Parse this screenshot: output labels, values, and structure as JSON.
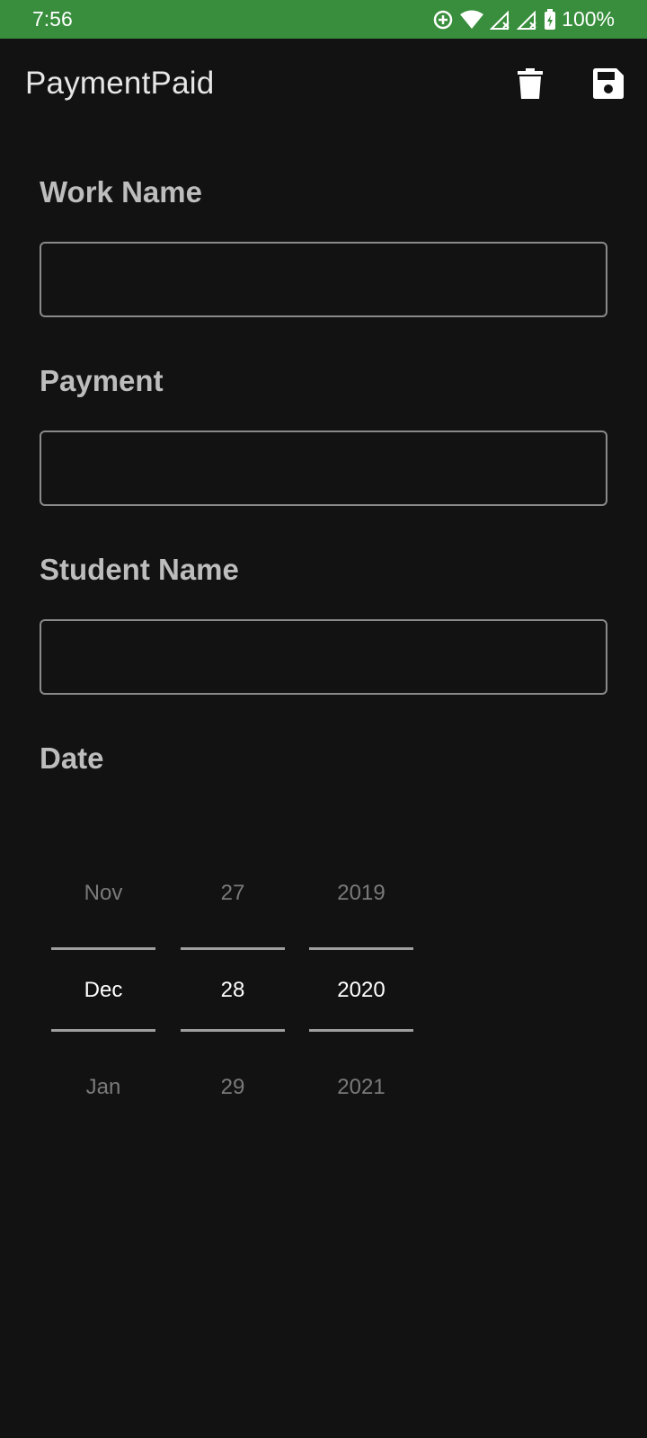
{
  "status_bar": {
    "time": "7:56",
    "battery": "100%",
    "icons": [
      "data-saver-icon",
      "wifi-icon",
      "signal-icon",
      "signal-icon",
      "battery-charging-icon"
    ],
    "background_color": "#388e3c"
  },
  "app_bar": {
    "title": "PaymentPaid",
    "actions": [
      {
        "name": "delete",
        "icon": "trash-icon"
      },
      {
        "name": "save",
        "icon": "save-icon"
      }
    ]
  },
  "form": {
    "work_name": {
      "label": "Work Name",
      "value": "",
      "placeholder": ""
    },
    "payment": {
      "label": "Payment",
      "value": "",
      "placeholder": ""
    },
    "student_name": {
      "label": "Student Name",
      "value": "",
      "placeholder": ""
    },
    "date": {
      "label": "Date",
      "month": {
        "prev": "Nov",
        "selected": "Dec",
        "next": "Jan"
      },
      "day": {
        "prev": "27",
        "selected": "28",
        "next": "29"
      },
      "year": {
        "prev": "2019",
        "selected": "2020",
        "next": "2021"
      }
    }
  }
}
